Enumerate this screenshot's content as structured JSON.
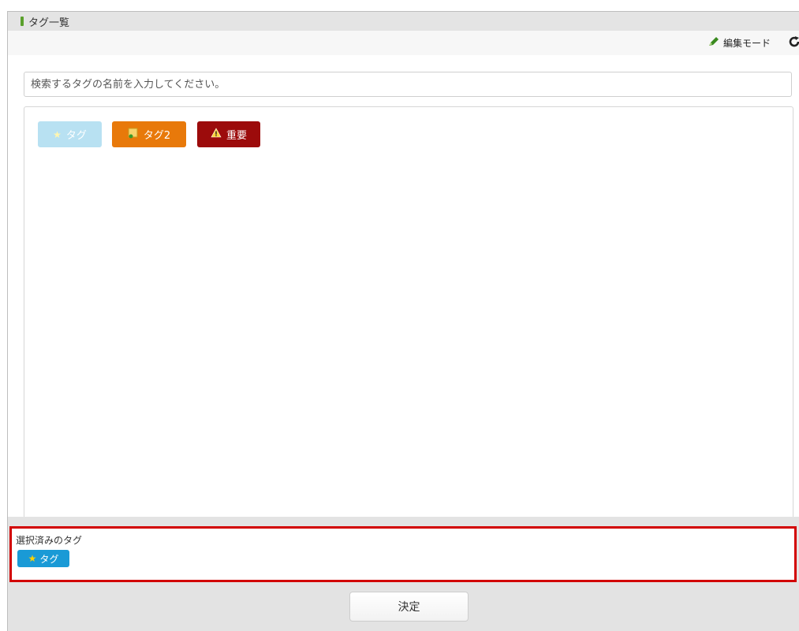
{
  "window": {
    "title": "タグ一覧",
    "title_marker_color": "#5aa02c"
  },
  "toolbar": {
    "edit_mode_label": "編集モード",
    "edit_icon": "pencil-icon",
    "refresh_icon": "refresh-icon"
  },
  "search": {
    "placeholder": "検索するタグの名前を入力してください。",
    "value": ""
  },
  "tags": [
    {
      "label": "タグ",
      "icon": "star-icon",
      "color": "#b8e1f2"
    },
    {
      "label": "タグ2",
      "icon": "note-icon",
      "color": "#e8790a"
    },
    {
      "label": "重要",
      "icon": "warning-icon",
      "color": "#9c0b0b"
    }
  ],
  "selected": {
    "label": "選択済みのタグ",
    "highlight_color": "#d20000",
    "tags": [
      {
        "label": "タグ",
        "icon": "star-icon",
        "color": "#1a9ad6"
      }
    ]
  },
  "footer": {
    "decide_label": "決定"
  }
}
